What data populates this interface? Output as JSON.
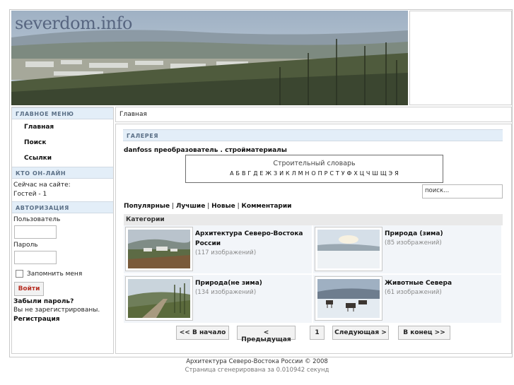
{
  "header": {
    "logo_text": "severdom.info"
  },
  "sidebar": {
    "main_menu_title": "ГЛАВНОЕ МЕНЮ",
    "menu_items": [
      {
        "label": "Главная"
      },
      {
        "label": "Поиск"
      },
      {
        "label": "Ссылки"
      }
    ],
    "online_title": "КТО ОН-ЛАЙН",
    "online_line1": "Сейчас на сайте:",
    "online_line2": "Гостей - 1",
    "auth_title": "АВТОРИЗАЦИЯ",
    "username_label": "Пользователь",
    "password_label": "Пароль",
    "remember_label": "Запомнить меня",
    "login_button": "Войти",
    "forgot_link": "Забыли пароль?",
    "not_registered": "Вы не зарегистрированы.",
    "register_link": "Регистрация"
  },
  "breadcrumb": "Главная",
  "gallery": {
    "title": "ГАЛЕРЕЯ",
    "related_text": "danfoss преобразователь . стройматериалы",
    "dictionary_title": "Строительный словарь",
    "dictionary_letters": "А Б В Г Д Е Ж З И К Л М Н О П Р С Т У Ф Х Ц Ч Ш Щ Э Я",
    "search_value": "поиск...",
    "filters": [
      "Популярные",
      "Лучшие",
      "Новые",
      "Комментарии"
    ],
    "filter_sep": " | ",
    "categories_title": "Категории",
    "categories": [
      {
        "name": "Архитектура Северо-Востока России",
        "count": "(117 изображений)",
        "icon": "town-photo"
      },
      {
        "name": "Природа (зима)",
        "count": "(85 изображений)",
        "icon": "winter-photo"
      },
      {
        "name": "Природа(не зима)",
        "count": "(134 изображений)",
        "icon": "forest-road-photo"
      },
      {
        "name": "Животные Севера",
        "count": "(61 изображений)",
        "icon": "reindeer-photo"
      }
    ],
    "pager": {
      "first": "<< В начало",
      "prev": "< Предыдущая",
      "page": "1",
      "next": "Следующая >",
      "last": "В конец >>"
    }
  },
  "footer": {
    "copyright": "Архитектура Северо-Востока России © 2008",
    "generated": "Страница сгенерирована за 0.010942 секунд"
  },
  "colors": {
    "module_header_bg": "#e3eef8",
    "module_header_text": "#5a6f86",
    "login_button_text": "#b73024"
  }
}
